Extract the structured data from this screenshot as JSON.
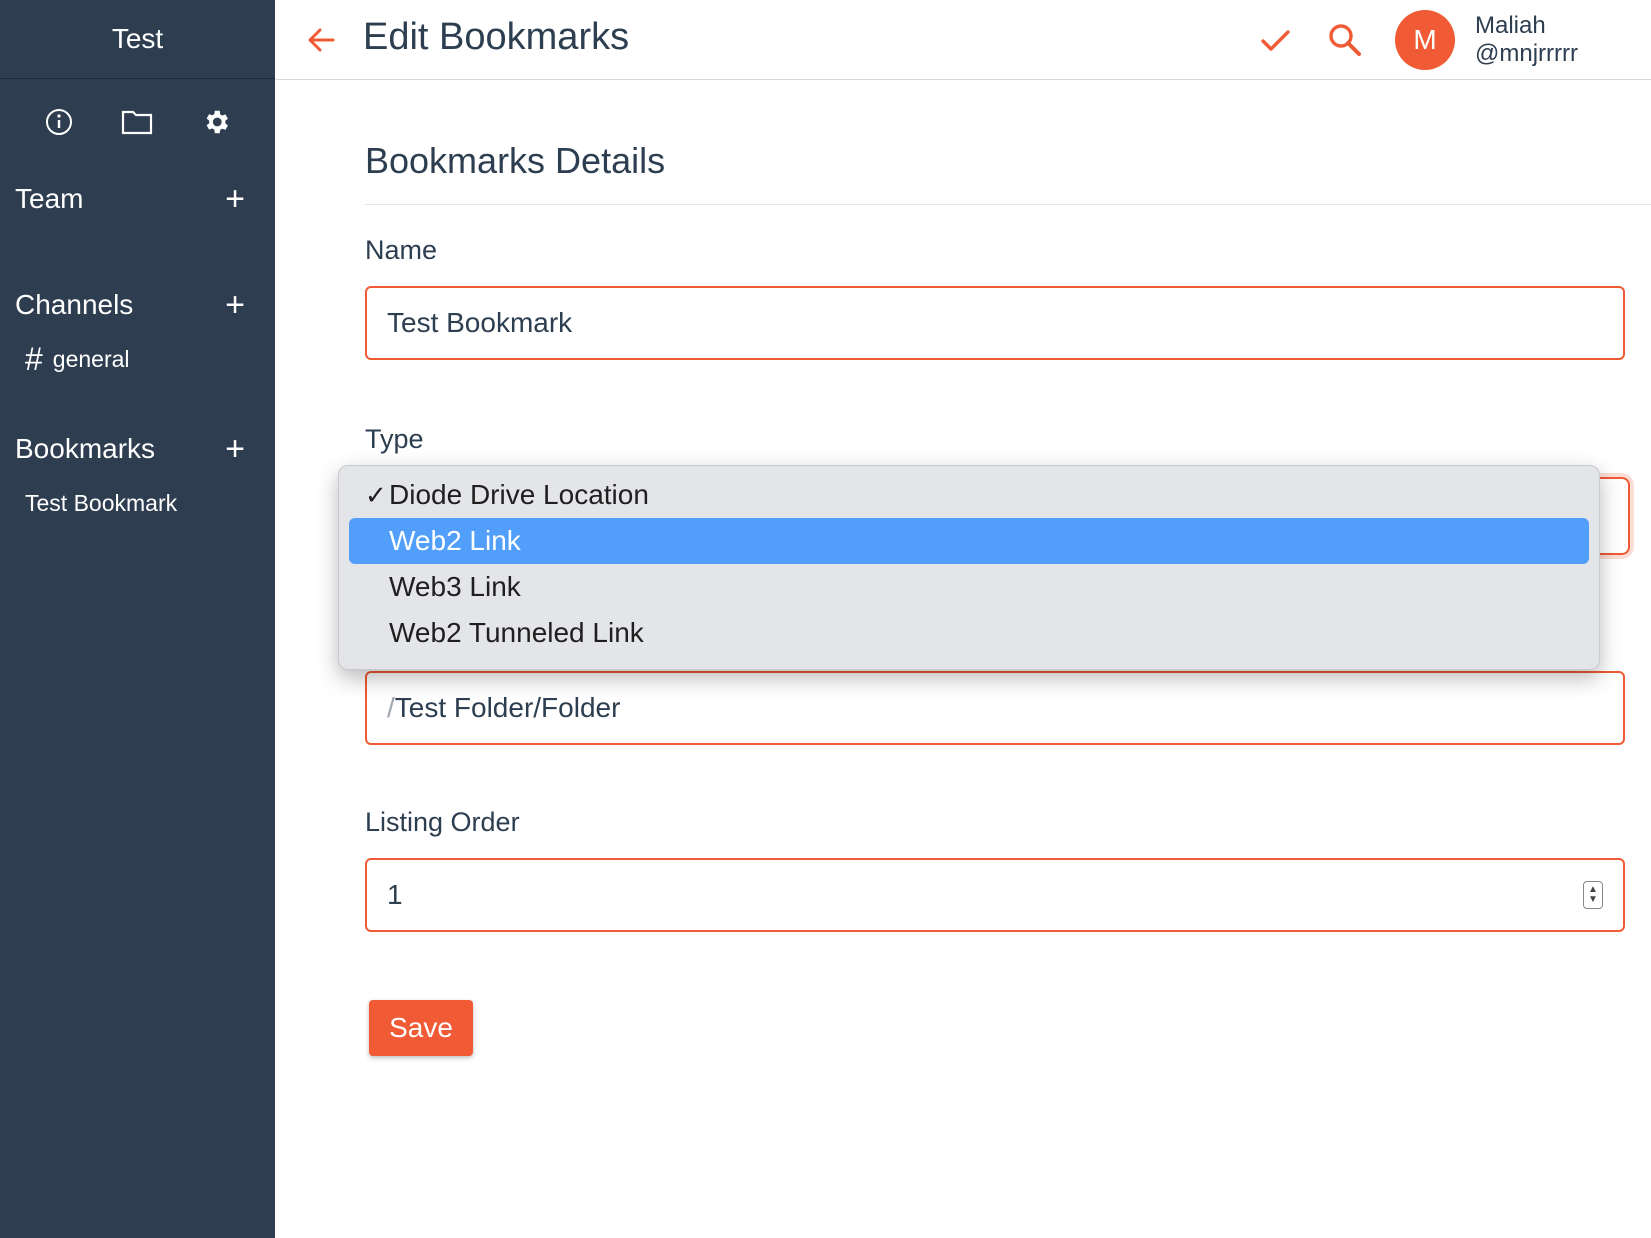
{
  "sidebar": {
    "title": "Test",
    "icons": [
      "info-icon",
      "folder-icon",
      "gear-icon"
    ],
    "team_label": "Team",
    "channels_label": "Channels",
    "channels": [
      {
        "name": "general"
      }
    ],
    "bookmarks_label": "Bookmarks",
    "bookmarks": [
      {
        "name": "Test Bookmark"
      }
    ]
  },
  "header": {
    "title": "Edit Bookmarks",
    "avatar_letter": "M",
    "user_name": "Maliah",
    "user_handle": "@mnjrrrrr"
  },
  "form": {
    "section_title": "Bookmarks Details",
    "name_label": "Name",
    "name_value": "Test Bookmark",
    "type_label": "Type",
    "type_options": [
      {
        "label": "Diode Drive Location",
        "checked": true
      },
      {
        "label": "Web2 Link",
        "highlighted": true
      },
      {
        "label": "Web3 Link"
      },
      {
        "label": "Web2 Tunneled Link"
      }
    ],
    "path_prefix": "/",
    "path_value": "Test Folder/Folder",
    "order_label": "Listing Order",
    "order_value": "1",
    "save_label": "Save"
  },
  "colors": {
    "accent": "#f05a34",
    "sidebar_bg": "#2e3d4f",
    "highlight": "#519ffa"
  }
}
